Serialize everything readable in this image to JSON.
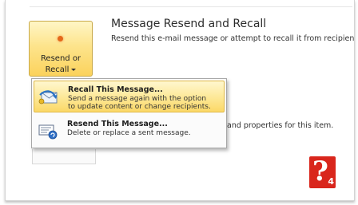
{
  "section": {
    "title": "Message Resend and Recall",
    "description": "Resend this e-mail message or attempt to recall it from recipients."
  },
  "resend_button": {
    "label_line1": "Resend or",
    "label_line2": "Recall"
  },
  "background_text": "and properties for this item.",
  "menu": {
    "items": [
      {
        "title": "Recall This Message...",
        "description": "Send a message again with the option\nto update content or change recipients."
      },
      {
        "title": "Resend This Message...",
        "description": "Delete or replace a sent message."
      }
    ]
  },
  "logo": {
    "mark": "?",
    "number": "4"
  },
  "colors": {
    "highlight": "#fde99a",
    "button_gradient_bottom": "#fbd25c",
    "logo": "#d9261c"
  }
}
